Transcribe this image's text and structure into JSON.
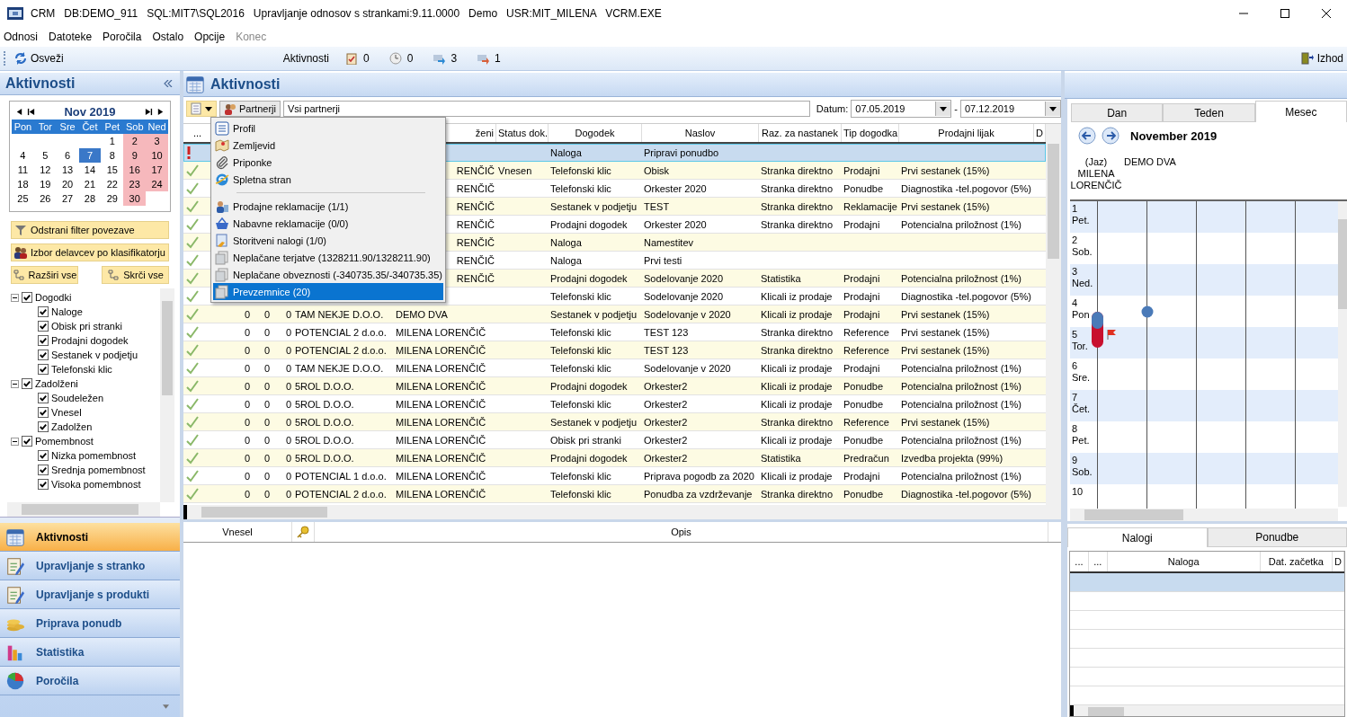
{
  "window": {
    "title": "CRM   DB:DEMO_911   SQL:MIT7\\SQL2016   Upravljanje odnosov s strankami:9.11.0000   Demo   USR:MIT_MILENA   VCRM.EXE"
  },
  "menu": [
    {
      "label": "Odnosi",
      "disabled": false
    },
    {
      "label": "Datoteke",
      "disabled": false
    },
    {
      "label": "Poročila",
      "disabled": false
    },
    {
      "label": "Ostalo",
      "disabled": false
    },
    {
      "label": "Opcije",
      "disabled": false
    },
    {
      "label": "Konec",
      "disabled": true
    }
  ],
  "toolbar": {
    "refresh": "Osveži",
    "label": "Aktivnosti",
    "counters": [
      "0",
      "0",
      "3",
      "1"
    ],
    "exit": "Izhod"
  },
  "sidebar": {
    "title": "Aktivnosti",
    "calendar": {
      "month": "Nov 2019",
      "weekdays": [
        "Pon",
        "Tor",
        "Sre",
        "Čet",
        "Pet",
        "Sob",
        "Ned"
      ],
      "weeks": [
        [
          {
            "day": "1",
            "selected": false
          },
          {
            "day": "2",
            "selected": false
          },
          {
            "day": "3",
            "selected": false
          }
        ],
        [
          {
            "day": "4",
            "selected": false
          },
          {
            "day": "5",
            "selected": false
          },
          {
            "day": "6",
            "selected": false
          },
          {
            "day": "7",
            "selected": true
          },
          {
            "day": "8",
            "selected": false
          },
          {
            "day": "9",
            "selected": false
          },
          {
            "day": "10",
            "selected": false
          }
        ],
        [
          {
            "day": "11",
            "selected": false
          },
          {
            "day": "12",
            "selected": false
          },
          {
            "day": "13",
            "selected": false
          },
          {
            "day": "14",
            "selected": false
          },
          {
            "day": "15",
            "selected": false
          },
          {
            "day": "16",
            "selected": false
          },
          {
            "day": "17",
            "selected": false
          }
        ],
        [
          {
            "day": "18",
            "selected": false
          },
          {
            "day": "19",
            "selected": false
          },
          {
            "day": "20",
            "selected": false
          },
          {
            "day": "21",
            "selected": false
          },
          {
            "day": "22",
            "selected": false
          },
          {
            "day": "23",
            "selected": false
          },
          {
            "day": "24",
            "selected": false
          }
        ],
        [
          {
            "day": "25",
            "selected": false
          },
          {
            "day": "26",
            "selected": false
          },
          {
            "day": "27",
            "selected": false
          },
          {
            "day": "28",
            "selected": false
          },
          {
            "day": "29",
            "selected": false
          },
          {
            "day": "30",
            "selected": false
          }
        ]
      ]
    },
    "buttons": [
      "Odstrani filter povezave",
      "Izbor delavcev po klasifikatorju"
    ],
    "expand_all": "Razširi vse",
    "collapse_all": "Skrči vse",
    "tree": [
      {
        "label": "Dogodki",
        "checked": true,
        "expanded": true,
        "children": [
          {
            "label": "Naloge",
            "checked": true
          },
          {
            "label": "Obisk pri stranki",
            "checked": true
          },
          {
            "label": "Prodajni dogodek",
            "checked": true
          },
          {
            "label": "Sestanek v podjetju",
            "checked": true
          },
          {
            "label": "Telefonski klic",
            "checked": true
          }
        ]
      },
      {
        "label": "Zadolženi",
        "checked": true,
        "expanded": true,
        "children": [
          {
            "label": "Soudeležen",
            "checked": true
          },
          {
            "label": "Vnesel",
            "checked": true
          },
          {
            "label": "Zadolžen",
            "checked": true
          }
        ]
      },
      {
        "label": "Pomembnost",
        "checked": true,
        "expanded": true,
        "children": [
          {
            "label": "Nizka pomembnost",
            "checked": true
          },
          {
            "label": "Srednja pomembnost",
            "checked": true
          },
          {
            "label": "Visoka pomembnost",
            "checked": true
          }
        ]
      }
    ],
    "nav": [
      {
        "label": "Aktivnosti",
        "selected": true
      },
      {
        "label": "Upravljanje s stranko",
        "selected": false
      },
      {
        "label": "Upravljanje s produkti",
        "selected": false
      },
      {
        "label": "Priprava ponudb",
        "selected": false
      },
      {
        "label": "Statistika",
        "selected": false
      },
      {
        "label": "Poročila",
        "selected": false
      }
    ]
  },
  "main": {
    "title": "Aktivnosti",
    "partners_button": "Partnerji",
    "partner_field": "Vsi partnerji",
    "date_label": "Datum:",
    "date_from": "07.05.2019",
    "date_sep": "-",
    "date_to": "07.12.2019",
    "columns": [
      "...",
      "ženi",
      "Status dok.",
      "Dogodek",
      "Naslov",
      "Raz. za nastanek",
      "Tip dogodka",
      "Prodajni lijak",
      "D"
    ],
    "rows": [
      {
        "kind": "alert",
        "selected": true,
        "event": "Naloga",
        "title": "Pripravi ponudbo"
      },
      {
        "kind": "done",
        "selected": false,
        "assignee": "RENČIČ",
        "status": "Vnesen",
        "event": "Telefonski klic",
        "title": "Obisk",
        "source": "Stranka direktno",
        "type": "Prodajni",
        "funnel": "Prvi sestanek (15%)"
      },
      {
        "kind": "done",
        "selected": false,
        "assignee": "RENČIČ",
        "event": "Telefonski klic",
        "title": "Orkester 2020",
        "source": "Stranka direktno",
        "type": "Ponudbe",
        "funnel": "Diagnostika -tel.pogovor (5%)"
      },
      {
        "kind": "done",
        "selected": false,
        "assignee": "RENČIČ",
        "event": "Sestanek v podjetju",
        "title": "TEST",
        "source": "Stranka direktno",
        "type": "Reklamacije",
        "funnel": "Prvi sestanek (15%)"
      },
      {
        "kind": "done",
        "selected": false,
        "assignee": "RENČIČ",
        "event": "Prodajni dogodek",
        "title": "Orkester 2020",
        "source": "Stranka direktno",
        "type": "Prodajni",
        "funnel": "Potencialna priložnost (1%)"
      },
      {
        "kind": "done",
        "selected": false,
        "assignee": "RENČIČ",
        "event": "Naloga",
        "title": "Namestitev"
      },
      {
        "kind": "done",
        "selected": false,
        "assignee": "RENČIČ",
        "event": "Naloga",
        "title": "Prvi testi"
      },
      {
        "kind": "done",
        "selected": false,
        "assignee": "RENČIČ",
        "event": "Prodajni dogodek",
        "title": "Sodelovanje 2020",
        "source": "Statistika",
        "type": "Prodajni",
        "funnel": "Potencialna priložnost (1%)"
      },
      {
        "kind": "done",
        "selected": false,
        "event": "Telefonski klic",
        "title": "Sodelovanje 2020",
        "source": "Klicali iz prodaje",
        "type": "Prodajni",
        "funnel": "Diagnostika -tel.pogovor (5%)"
      },
      {
        "kind": "done",
        "selected": false,
        "n1": "0",
        "n2": "0",
        "n3": "0",
        "partner": "TAM NEKJE D.O.O.",
        "assignee": "DEMO DVA",
        "event": "Sestanek v podjetju",
        "title": "Sodelovanje v 2020",
        "source": "Klicali iz prodaje",
        "type": "Prodajni",
        "funnel": "Prvi sestanek (15%)"
      },
      {
        "kind": "done",
        "selected": false,
        "n1": "0",
        "n2": "0",
        "n3": "0",
        "partner": "POTENCIAL 2 d.o.o.",
        "assignee": "MILENA LORENČIČ",
        "event": "Telefonski klic",
        "title": "TEST 123",
        "source": "Stranka direktno",
        "type": "Reference",
        "funnel": "Prvi sestanek (15%)"
      },
      {
        "kind": "done",
        "selected": false,
        "n1": "0",
        "n2": "0",
        "n3": "0",
        "partner": "POTENCIAL 2 d.o.o.",
        "assignee": "MILENA LORENČIČ",
        "event": "Telefonski klic",
        "title": "TEST 123",
        "source": "Stranka direktno",
        "type": "Reference",
        "funnel": "Prvi sestanek (15%)"
      },
      {
        "kind": "done",
        "selected": false,
        "n1": "0",
        "n2": "0",
        "n3": "0",
        "partner": "TAM NEKJE D.O.O.",
        "assignee": "MILENA LORENČIČ",
        "event": "Telefonski klic",
        "title": "Sodelovanje v 2020",
        "source": "Klicali iz prodaje",
        "type": "Prodajni",
        "funnel": "Potencialna priložnost (1%)"
      },
      {
        "kind": "done",
        "selected": false,
        "n1": "0",
        "n2": "0",
        "n3": "0",
        "partner": "5ROL D.O.O.",
        "assignee": "MILENA LORENČIČ",
        "event": "Prodajni dogodek",
        "title": "Orkester2",
        "source": "Klicali iz prodaje",
        "type": "Ponudbe",
        "funnel": "Potencialna priložnost (1%)"
      },
      {
        "kind": "done",
        "selected": false,
        "n1": "0",
        "n2": "0",
        "n3": "0",
        "partner": "5ROL D.O.O.",
        "assignee": "MILENA LORENČIČ",
        "event": "Telefonski klic",
        "title": "Orkester2",
        "source": "Klicali iz prodaje",
        "type": "Ponudbe",
        "funnel": "Potencialna priložnost (1%)"
      },
      {
        "kind": "done",
        "selected": false,
        "n1": "0",
        "n2": "0",
        "n3": "0",
        "partner": "5ROL D.O.O.",
        "assignee": "MILENA LORENČIČ",
        "event": "Sestanek v podjetju",
        "title": "Orkester2",
        "source": "Stranka direktno",
        "type": "Reference",
        "funnel": "Prvi sestanek (15%)"
      },
      {
        "kind": "done",
        "selected": false,
        "n1": "0",
        "n2": "0",
        "n3": "0",
        "partner": "5ROL D.O.O.",
        "assignee": "MILENA LORENČIČ",
        "event": "Obisk pri stranki",
        "title": "Orkester2",
        "source": "Klicali iz prodaje",
        "type": "Ponudbe",
        "funnel": "Potencialna priložnost (1%)"
      },
      {
        "kind": "done",
        "selected": false,
        "n1": "0",
        "n2": "0",
        "n3": "0",
        "partner": "5ROL D.O.O.",
        "assignee": "MILENA LORENČIČ",
        "event": "Prodajni dogodek",
        "title": "Orkester2",
        "source": "Statistika",
        "type": "Predračun",
        "funnel": "Izvedba projekta (99%)"
      },
      {
        "kind": "done",
        "selected": false,
        "n1": "0",
        "n2": "0",
        "n3": "0",
        "partner": "POTENCIAL 1 d.o.o.",
        "assignee": "MILENA LORENČIČ",
        "event": "Telefonski klic",
        "title": "Priprava pogodb za 2020",
        "source": "Klicali iz prodaje",
        "type": "Prodajni",
        "funnel": "Potencialna priložnost (1%)"
      },
      {
        "kind": "done",
        "selected": false,
        "n1": "0",
        "n2": "0",
        "n3": "0",
        "partner": "POTENCIAL 2 d.o.o.",
        "assignee": "MILENA LORENČIČ",
        "event": "Telefonski klic",
        "title": "Ponudba za vzdrževanje",
        "source": "Stranka direktno",
        "type": "Ponudbe",
        "funnel": "Diagnostika -tel.pogovor (5%)"
      }
    ],
    "context_menu": [
      {
        "kind": "item",
        "label": "Profil",
        "selected": false
      },
      {
        "kind": "item",
        "label": "Zemljevid",
        "selected": false
      },
      {
        "kind": "item",
        "label": "Priponke",
        "selected": false
      },
      {
        "kind": "item",
        "label": "Spletna stran",
        "selected": false
      },
      {
        "kind": "separator"
      },
      {
        "kind": "item",
        "label": "Prodajne reklamacije (1/1)",
        "selected": false
      },
      {
        "kind": "item",
        "label": "Nabavne reklamacije (0/0)",
        "selected": false
      },
      {
        "kind": "item",
        "label": "Storitveni nalogi (1/0)",
        "selected": false
      },
      {
        "kind": "item",
        "label": "Neplačane terjatve (1328211.90/1328211.90)",
        "selected": false
      },
      {
        "kind": "item",
        "label": "Neplačane obveznosti (-340735.35/-340735.35)",
        "selected": false
      },
      {
        "kind": "item",
        "label": "Prevzemnice (20)",
        "selected": true
      }
    ],
    "detail_columns": [
      "Vnesel",
      "Opis"
    ]
  },
  "calendar": {
    "tabs": [
      {
        "label": "Dan",
        "selected": false
      },
      {
        "label": "Teden",
        "selected": false
      },
      {
        "label": "Mesec",
        "selected": true
      }
    ],
    "title": "November 2019",
    "people": [
      "(Jaz) MILENA LORENČIČ",
      "DEMO DVA"
    ],
    "days": [
      {
        "day": "1",
        "weekday": "Pet."
      },
      {
        "day": "2",
        "weekday": "Sob."
      },
      {
        "day": "3",
        "weekday": "Ned."
      },
      {
        "day": "4",
        "weekday": "Pon",
        "entries": [
          {
            "kind": "span"
          },
          {
            "kind": "dot"
          }
        ]
      },
      {
        "day": "5",
        "weekday": "Tor."
      },
      {
        "day": "6",
        "weekday": "Sre."
      },
      {
        "day": "7",
        "weekday": "Čet."
      },
      {
        "day": "8",
        "weekday": "Pet."
      },
      {
        "day": "9",
        "weekday": "Sob."
      },
      {
        "day": "10"
      }
    ]
  },
  "tasks": {
    "tabs": [
      {
        "label": "Nalogi",
        "selected": true
      },
      {
        "label": "Ponudbe",
        "selected": false
      }
    ],
    "columns": [
      "...",
      "...",
      "Naloga",
      "Dat. začetka",
      "D"
    ],
    "rows": [
      {
        "selected": true
      },
      {
        "selected": false
      },
      {
        "selected": false
      },
      {
        "selected": false
      },
      {
        "selected": false
      },
      {
        "selected": false
      },
      {
        "selected": false
      }
    ]
  }
}
